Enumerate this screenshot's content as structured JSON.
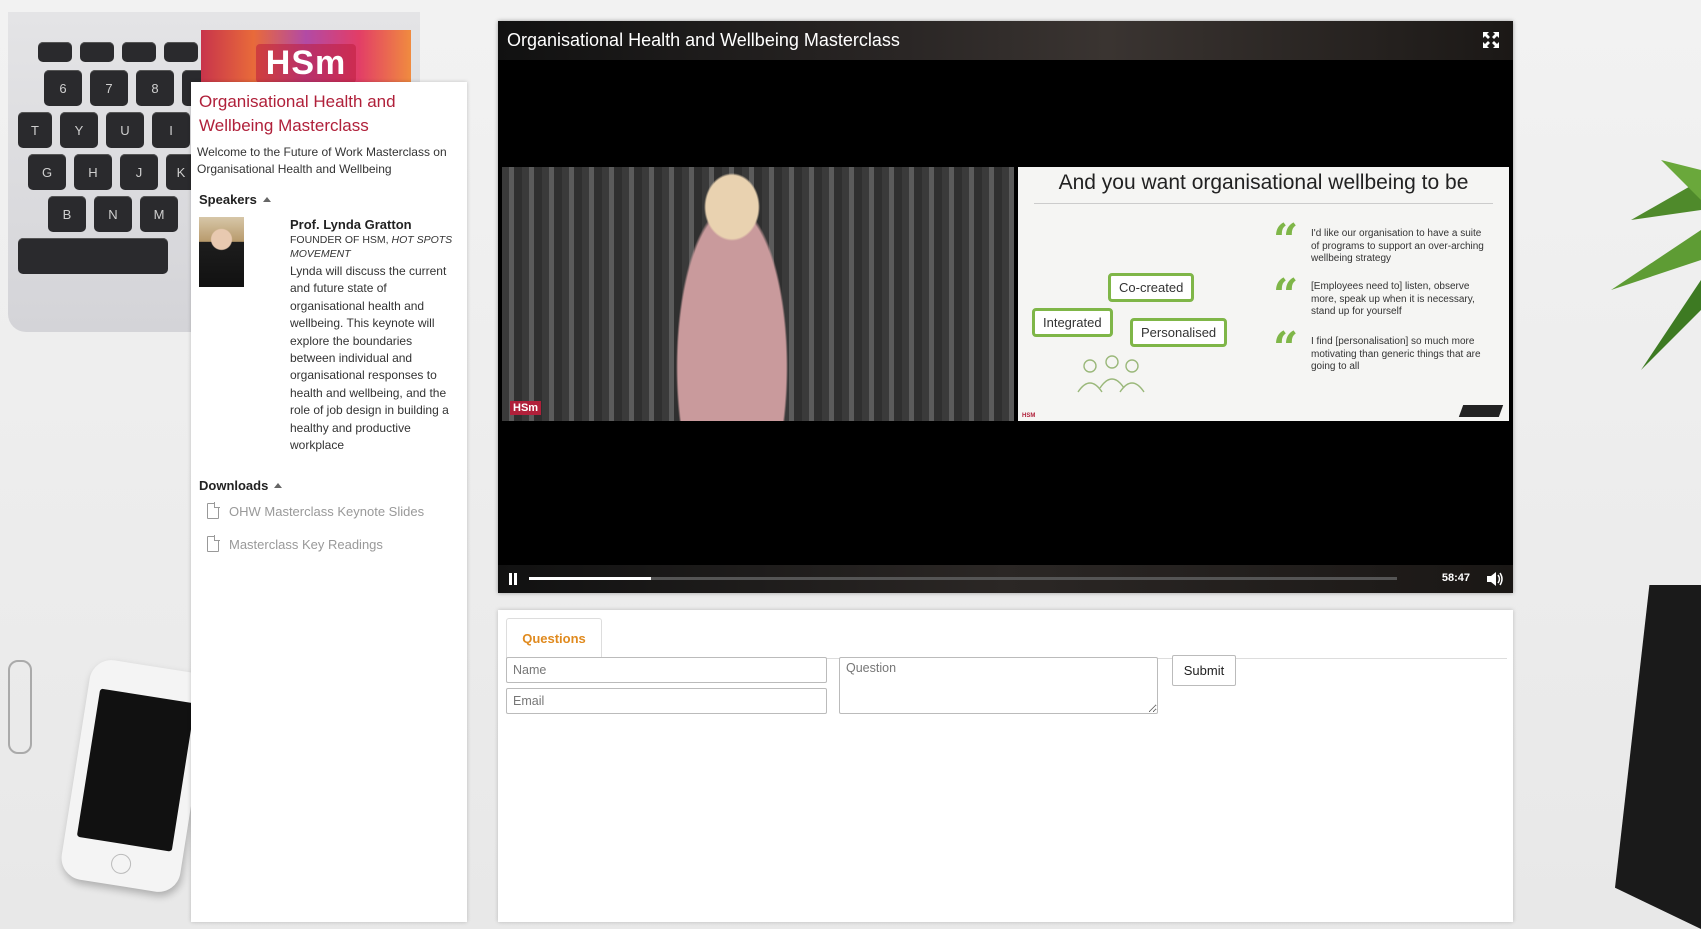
{
  "branding": {
    "logo_text": "HSm",
    "video_watermark": "HSm",
    "slide_watermark": "HSM"
  },
  "sidebar": {
    "title": "Organisational Health and Wellbeing Masterclass",
    "welcome": "Welcome to the Future of Work Masterclass on Organisational Health and Wellbeing",
    "speakers_heading": "Speakers",
    "speaker": {
      "name": "Prof. Lynda Gratton",
      "role_prefix": "FOUNDER OF HSM,",
      "role_italic": "HOT SPOTS MOVEMENT",
      "description": "Lynda will discuss the current and future state of organisational health and wellbeing. This keynote will explore the boundaries between individual and organisational responses to health and wellbeing, and the role of job design in building a healthy and productive workplace"
    },
    "downloads_heading": "Downloads",
    "downloads": [
      {
        "label": "OHW Masterclass Keynote Slides"
      },
      {
        "label": "Masterclass Key Readings"
      }
    ]
  },
  "player": {
    "title": "Organisational Health and Wellbeing Masterclass",
    "time": "58:47",
    "progress_fraction": 0.14,
    "slide": {
      "title": "And you want organisational wellbeing to be",
      "bubbles": [
        "Co-created",
        "Integrated",
        "Personalised"
      ],
      "quotes": [
        "I'd like our organisation to have a suite of programs to support an over-arching wellbeing strategy",
        "[Employees need to] listen, observe more, speak up when it is necessary, stand up for yourself",
        "I find [personalisation] so much more motivating than generic things that are going to all"
      ]
    }
  },
  "questions": {
    "tab_label": "Questions",
    "name_placeholder": "Name",
    "email_placeholder": "Email",
    "question_placeholder": "Question",
    "submit_label": "Submit"
  },
  "colors": {
    "accent_red": "#b0203a",
    "tab_orange": "#e08a1e",
    "slide_green": "#7fb648"
  }
}
